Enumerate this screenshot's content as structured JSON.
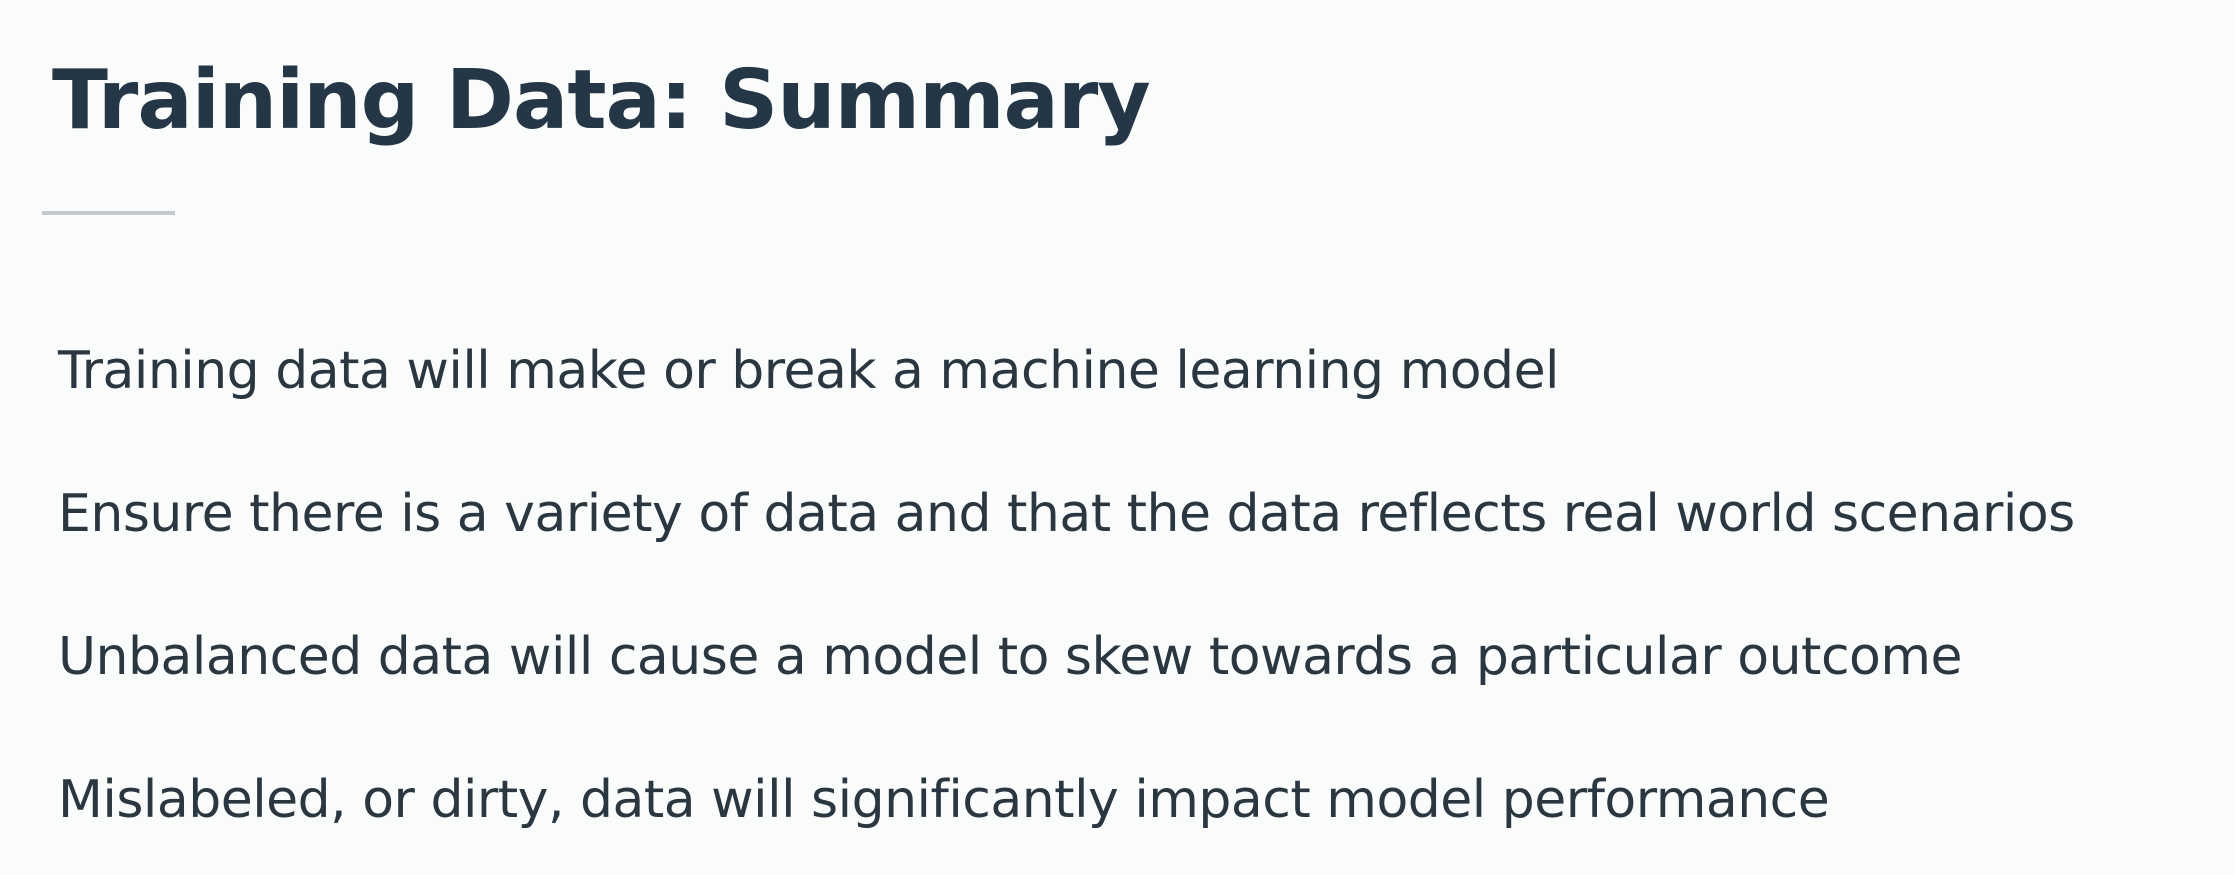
{
  "slide": {
    "title": "Training Data: Summary",
    "bullets": [
      "Training data will make or break a machine learning model",
      "Ensure there is a variety of data and that the data reflects real world scenarios",
      "Unbalanced data will cause a model to skew towards a particular outcome",
      "Mislabeled, or dirty, data will significantly impact model performance"
    ]
  },
  "colors": {
    "background": "#fafbfb",
    "title": "#253746",
    "text": "#2a3640",
    "rule": "#c4c9ce"
  }
}
